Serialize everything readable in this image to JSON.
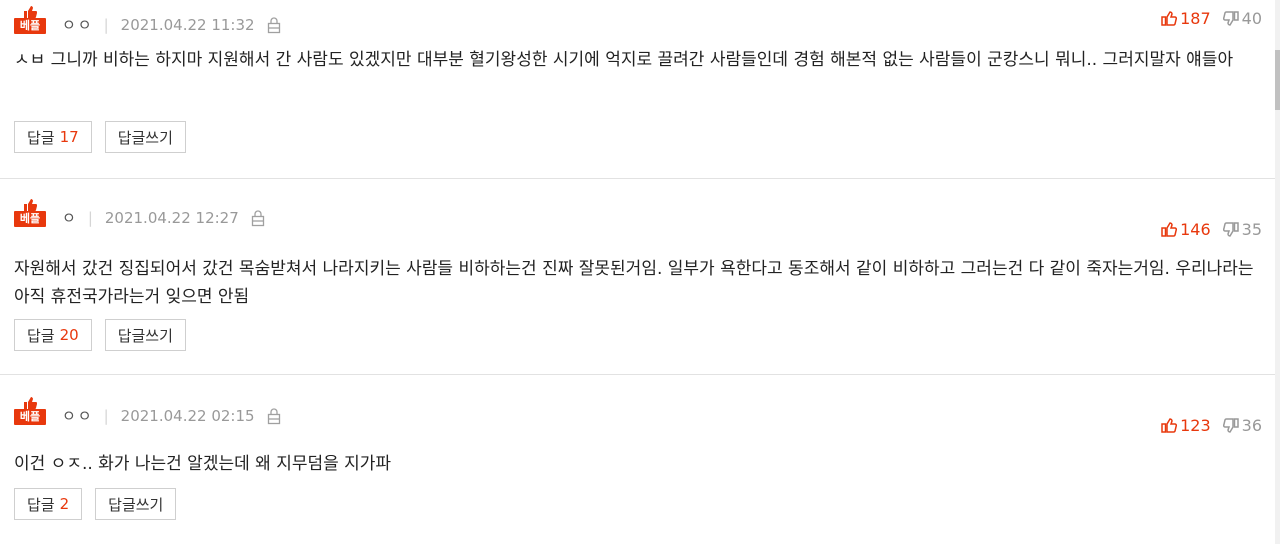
{
  "colors": {
    "accent": "#e8380d",
    "muted": "#999999",
    "border": "#cfcfcf"
  },
  "icons": {
    "best": "thumbs-up-icon",
    "lock": "lock-icon",
    "vote_up": "thumbs-up-icon",
    "vote_down": "thumbs-down-icon"
  },
  "comments": [
    {
      "badge": "베플",
      "nickname": "ㅇㅇ",
      "date": "2021.04.22 11:32",
      "likes": "187",
      "dislikes": "40",
      "text": "ㅅㅂ 그니까 비하는 하지마 지원해서 간 사람도 있겠지만 대부분 혈기왕성한 시기에 억지로 끌려간 사람들인데 경험 해본적 없는 사람들이 군캉스니 뭐니.. 그러지말자 얘들아",
      "reply_label": "답글",
      "reply_count": "17",
      "write_reply_label": "답글쓰기"
    },
    {
      "badge": "베플",
      "nickname": "ㅇ",
      "date": "2021.04.22 12:27",
      "likes": "146",
      "dislikes": "35",
      "text": "자원해서 갔건 징집되어서 갔건 목숨받쳐서 나라지키는 사람들 비하하는건 진짜 잘못된거임. 일부가 욕한다고 동조해서 같이 비하하고 그러는건 다 같이 죽자는거임. 우리나라는 아직 휴전국가라는거 잊으면 안됨",
      "reply_label": "답글",
      "reply_count": "20",
      "write_reply_label": "답글쓰기"
    },
    {
      "badge": "베플",
      "nickname": "ㅇㅇ",
      "date": "2021.04.22 02:15",
      "likes": "123",
      "dislikes": "36",
      "text": "이건 ㅇㅈ.. 화가 나는건 알겠는데 왜 지무덤을 지가파",
      "reply_label": "답글",
      "reply_count": "2",
      "write_reply_label": "답글쓰기"
    }
  ]
}
